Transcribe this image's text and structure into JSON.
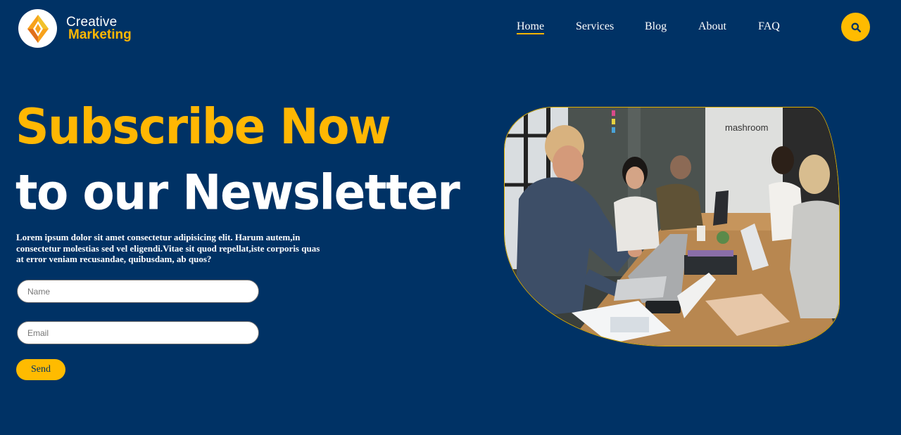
{
  "brand": {
    "line1": "Creative",
    "line2": "Marketing",
    "logo_icon": "diamond-logo-icon"
  },
  "nav": [
    {
      "label": "Home",
      "active": true
    },
    {
      "label": "Services",
      "active": false
    },
    {
      "label": "Blog",
      "active": false
    },
    {
      "label": "About",
      "active": false
    },
    {
      "label": "FAQ",
      "active": false
    }
  ],
  "search": {
    "icon": "search-icon"
  },
  "hero": {
    "title_line1": "Subscribe Now",
    "title_line2": "to our Newsletter",
    "description": "Lorem ipsum dolor sit amet consectetur adipisicing elit. Harum autem,in consectetur molestias sed vel eligendi.Vitae sit quod repellat,iste corporis quas at error veniam recusandae, quibusdam, ab quos?"
  },
  "form": {
    "name_placeholder": "Name",
    "email_placeholder": "Email",
    "send_label": "Send"
  },
  "photo": {
    "sign_text": "mashroom"
  },
  "colors": {
    "background": "#003265",
    "accent": "#ffb703",
    "text": "#ffffff"
  }
}
